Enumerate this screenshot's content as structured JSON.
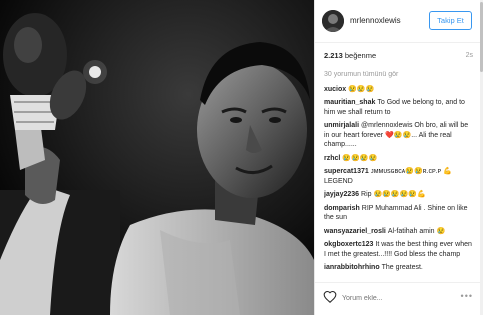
{
  "header": {
    "username": "mrlennoxlewis",
    "follow_label": "Takip Et"
  },
  "stats": {
    "likes_count": "2.213",
    "likes_word": "beğenme",
    "time_ago": "2s"
  },
  "comments_section": {
    "load_more": "30 yorumun tümünü gör",
    "items": [
      {
        "user": "xuciox",
        "text": "😢😢😢"
      },
      {
        "user": "mauritian_shak",
        "text": "To God we belong to, and to him we shall return to"
      },
      {
        "user": "unmirjalali",
        "text": "@mrlennoxlewis Oh bro, ali will be in our heart forever ❤️😢😢... Ali the real champ......"
      },
      {
        "user": "rzhcl",
        "text": "😢😢😢😢"
      },
      {
        "user": "supercat1371",
        "text": "ᴊᴍᴍᴜsɢʙᴄᴀ😢😢ʀ.ᴄᴘ.ᴘ 💪 LEGEND"
      },
      {
        "user": "jayjay2236",
        "text": "Rip 😢😢😢😢😢💪"
      },
      {
        "user": "domparish",
        "text": "RIP Muhammad Ali . Shine on like the sun"
      },
      {
        "user": "wansyazariel_rosli",
        "text": "Al-fatihah amin 😢"
      },
      {
        "user": "okgboxertc123",
        "text": "It was the best thing ever when I met the greatest...!!!! God bless the champ"
      },
      {
        "user": "ianrabbitohrhino",
        "text": "The greatest."
      }
    ]
  },
  "footer": {
    "comment_placeholder": "Yorum ekle...",
    "more_label": "•••"
  },
  "colors": {
    "accent": "#3897f0",
    "text": "#262626",
    "muted": "#999999"
  },
  "icons": [
    "heart-icon",
    "more-options-icon"
  ]
}
